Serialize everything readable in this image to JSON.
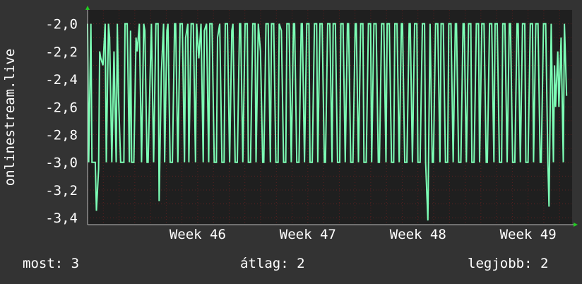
{
  "colors": {
    "background": "#333333",
    "plot_background": "#1f1f1f",
    "grid": "#5a2020",
    "line": "#7dffb6",
    "arrow": "#22cc22",
    "text": "#ffffff"
  },
  "legend": {
    "most_label": "most:",
    "most_value": "3",
    "atlag_label": "átlag:",
    "atlag_value": "2",
    "legjobb_label": "legjobb:",
    "legjobb_value": "2"
  },
  "chart_data": {
    "type": "line",
    "ylabel": "onlinestream.live",
    "ylim": [
      -3.45,
      -1.9
    ],
    "yticks": [
      -2.0,
      -2.2,
      -2.4,
      -2.6,
      -2.8,
      -3.0,
      -3.2,
      -3.4
    ],
    "ytick_labels": [
      "-2,0",
      "-2,2",
      "-2,4",
      "-2,6",
      "-2,8",
      "-3,0",
      "-3,2",
      "-3,4"
    ],
    "x_range_weeks": [
      45.0,
      49.4
    ],
    "xticks": [
      46,
      47,
      48,
      49
    ],
    "xtick_labels": [
      "Week 46",
      "Week 47",
      "Week 48",
      "Week 49"
    ],
    "grid": true,
    "series": [
      {
        "x": [
          45.0,
          45.01,
          45.03,
          45.04,
          45.07,
          45.08,
          45.1,
          45.11,
          45.12,
          45.14,
          45.16,
          45.17,
          45.19,
          45.2,
          45.22,
          45.24,
          45.26,
          45.27,
          45.28,
          45.3,
          45.33,
          45.34,
          45.36,
          45.38,
          45.39,
          45.4,
          45.42,
          45.44,
          45.45,
          45.47,
          45.49,
          45.51,
          45.52,
          45.54,
          45.55,
          45.57,
          45.58,
          45.6,
          45.62,
          45.64,
          45.65,
          45.67,
          45.69,
          45.7,
          45.72,
          45.73,
          45.75,
          45.77,
          45.79,
          45.8,
          45.82,
          45.84,
          45.86,
          45.88,
          45.89,
          45.91,
          45.92,
          45.94,
          45.96,
          45.98,
          45.99,
          46.01,
          46.03,
          46.05,
          46.06,
          46.08,
          46.1,
          46.11,
          46.13,
          46.15,
          46.17,
          46.18,
          46.2,
          46.22,
          46.24,
          46.25,
          46.27,
          46.29,
          46.31,
          46.32,
          46.34,
          46.36,
          46.38,
          46.39,
          46.41,
          46.43,
          46.45,
          46.46,
          46.48,
          46.5,
          46.52,
          46.53,
          46.55,
          46.57,
          46.59,
          46.6,
          46.62,
          46.64,
          46.66,
          46.67,
          46.69,
          46.71,
          46.73,
          46.74,
          46.76,
          46.78,
          46.8,
          46.81,
          46.83,
          46.85,
          46.87,
          46.88,
          46.9,
          46.92,
          46.94,
          46.95,
          46.97,
          46.99,
          47.01,
          47.02,
          47.04,
          47.06,
          47.08,
          47.09,
          47.11,
          47.13,
          47.15,
          47.16,
          47.18,
          47.2,
          47.22,
          47.23,
          47.25,
          47.27,
          47.29,
          47.3,
          47.32,
          47.34,
          47.36,
          47.37,
          47.39,
          47.41,
          47.43,
          47.44,
          47.46,
          47.48,
          47.5,
          47.51,
          47.53,
          47.55,
          47.57,
          47.58,
          47.6,
          47.62,
          47.64,
          47.65,
          47.67,
          47.69,
          47.71,
          47.72,
          47.74,
          47.76,
          47.78,
          47.79,
          47.81,
          47.83,
          47.85,
          47.86,
          47.88,
          47.9,
          47.92,
          47.93,
          47.95,
          47.97,
          47.99,
          48.0,
          48.02,
          48.04,
          48.06,
          48.07,
          48.09,
          48.11,
          48.13,
          48.14,
          48.16,
          48.18,
          48.2,
          48.21,
          48.23,
          48.25,
          48.27,
          48.28,
          48.3,
          48.32,
          48.34,
          48.35,
          48.37,
          48.39,
          48.41,
          48.42,
          48.44,
          48.46,
          48.48,
          48.49,
          48.51,
          48.53,
          48.55,
          48.56,
          48.58,
          48.6,
          48.62,
          48.63,
          48.65,
          48.67,
          48.69,
          48.7,
          48.72,
          48.74,
          48.76,
          48.77,
          48.79,
          48.81,
          48.83,
          48.84,
          48.86,
          48.88,
          48.9,
          48.91,
          48.93,
          48.95,
          48.97,
          48.98,
          49.0,
          49.02,
          49.04,
          49.05,
          49.07,
          49.09,
          49.11,
          49.12,
          49.14,
          49.16,
          49.18,
          49.19,
          49.21,
          49.23,
          49.24,
          49.25,
          49.27,
          49.28,
          49.3,
          49.32,
          49.33,
          49.35
        ],
        "y": [
          -2.0,
          -3.0,
          -2.0,
          -3.0,
          -3.0,
          -3.35,
          -3.05,
          -2.2,
          -2.25,
          -2.3,
          -2.0,
          -3.0,
          -2.0,
          -2.1,
          -3.0,
          -2.2,
          -3.0,
          -2.0,
          -2.5,
          -3.0,
          -3.0,
          -2.0,
          -2.0,
          -3.0,
          -2.05,
          -3.0,
          -3.0,
          -2.1,
          -2.2,
          -2.0,
          -3.0,
          -2.0,
          -2.05,
          -3.0,
          -3.0,
          -2.3,
          -2.0,
          -3.0,
          -2.0,
          -2.0,
          -3.28,
          -2.35,
          -2.0,
          -3.0,
          -2.05,
          -2.0,
          -3.0,
          -3.0,
          -2.0,
          -2.0,
          -3.0,
          -2.0,
          -2.0,
          -3.0,
          -2.1,
          -2.0,
          -3.0,
          -2.0,
          -2.0,
          -3.0,
          -2.0,
          -2.25,
          -2.0,
          -3.0,
          -2.05,
          -2.0,
          -3.0,
          -2.0,
          -2.0,
          -3.0,
          -3.0,
          -2.1,
          -2.0,
          -3.0,
          -3.0,
          -2.0,
          -2.0,
          -3.0,
          -2.05,
          -2.0,
          -3.0,
          -3.0,
          -2.0,
          -2.0,
          -3.0,
          -2.0,
          -2.0,
          -3.0,
          -3.0,
          -2.0,
          -2.0,
          -3.0,
          -2.0,
          -2.2,
          -3.0,
          -3.0,
          -2.0,
          -2.0,
          -3.0,
          -2.0,
          -2.0,
          -3.0,
          -3.0,
          -2.0,
          -2.05,
          -3.0,
          -3.0,
          -2.0,
          -2.0,
          -3.0,
          -2.0,
          -2.0,
          -3.0,
          -3.0,
          -2.0,
          -2.0,
          -3.0,
          -2.0,
          -2.0,
          -3.0,
          -3.0,
          -2.0,
          -2.0,
          -3.0,
          -2.0,
          -2.0,
          -3.0,
          -3.0,
          -2.0,
          -2.0,
          -3.0,
          -2.0,
          -2.0,
          -3.0,
          -3.0,
          -2.0,
          -2.0,
          -3.0,
          -2.0,
          -2.0,
          -3.0,
          -3.0,
          -2.0,
          -2.0,
          -3.0,
          -2.0,
          -2.0,
          -3.0,
          -3.0,
          -2.0,
          -2.0,
          -3.0,
          -2.0,
          -2.0,
          -3.0,
          -3.0,
          -2.0,
          -2.0,
          -3.0,
          -2.0,
          -2.0,
          -3.0,
          -3.0,
          -2.0,
          -2.0,
          -3.0,
          -2.0,
          -2.0,
          -3.0,
          -3.0,
          -2.0,
          -2.0,
          -3.0,
          -2.0,
          -2.0,
          -3.0,
          -3.0,
          -2.0,
          -2.0,
          -3.0,
          -3.42,
          -2.0,
          -3.0,
          -3.0,
          -2.0,
          -2.0,
          -3.0,
          -2.0,
          -2.0,
          -3.0,
          -3.0,
          -2.0,
          -2.0,
          -3.0,
          -2.0,
          -2.0,
          -3.0,
          -3.0,
          -2.0,
          -2.0,
          -3.0,
          -2.0,
          -2.0,
          -3.0,
          -3.0,
          -2.0,
          -2.0,
          -3.0,
          -2.0,
          -2.0,
          -3.0,
          -3.0,
          -2.0,
          -2.0,
          -3.0,
          -2.0,
          -2.0,
          -3.0,
          -3.0,
          -2.0,
          -2.0,
          -3.0,
          -2.0,
          -2.0,
          -3.0,
          -3.0,
          -2.0,
          -2.0,
          -3.0,
          -2.0,
          -2.0,
          -3.0,
          -3.0,
          -2.0,
          -2.0,
          -3.0,
          -2.0,
          -2.0,
          -3.0,
          -3.0,
          -2.0,
          -2.0,
          -3.0,
          -3.32,
          -2.0,
          -3.0,
          -2.3,
          -2.6,
          -2.2,
          -2.6,
          -2.1,
          -3.0,
          -2.0,
          -2.52
        ]
      }
    ]
  }
}
